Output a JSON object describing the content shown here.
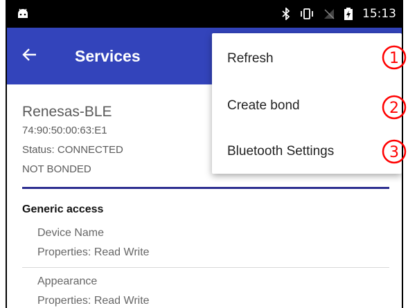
{
  "status_bar": {
    "time": "15:13",
    "icons": [
      "android-icon",
      "bluetooth-icon",
      "vibrate-icon",
      "no-sim-icon",
      "battery-charging-icon"
    ]
  },
  "app_bar": {
    "title": "Services",
    "back_icon": "arrow-left-icon"
  },
  "device": {
    "name": "Renesas-BLE",
    "address": "74:90:50:00:63:E1",
    "status": "Status:  CONNECTED",
    "bond_state": "NOT BONDED"
  },
  "services": [
    {
      "title": "Generic access",
      "characteristics": [
        {
          "name": "Device Name",
          "properties": "Properties: Read Write"
        },
        {
          "name": "Appearance",
          "properties": "Properties: Read Write"
        }
      ]
    }
  ],
  "menu": {
    "items": [
      {
        "label": "Refresh",
        "badge": "①"
      },
      {
        "label": "Create bond",
        "badge": "②"
      },
      {
        "label": "Bluetooth Settings",
        "badge": "③"
      }
    ]
  },
  "colors": {
    "app_bar": "#3344bb",
    "divider": "#2b2d8f",
    "badge": "#ff0000"
  }
}
